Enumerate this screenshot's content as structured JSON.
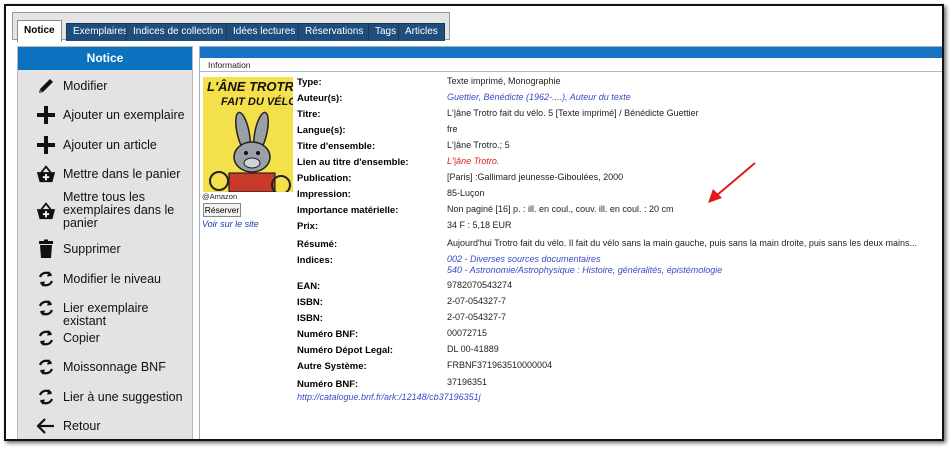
{
  "tabs": [
    "Notice",
    "Exemplaires",
    "Indices de collection",
    "Idées lectures",
    "Réservations",
    "Tags",
    "Articles"
  ],
  "sidebar": {
    "title": "Notice",
    "items": [
      {
        "label": "Modifier",
        "icon": "pencil-icon"
      },
      {
        "label": "Ajouter un exemplaire",
        "icon": "plus-icon"
      },
      {
        "label": "Ajouter un article",
        "icon": "plus-icon"
      },
      {
        "label": "Mettre dans le panier",
        "icon": "basket-add-icon"
      },
      {
        "label": "Mettre tous les exemplaires dans le panier",
        "icon": "basket-add-icon"
      },
      {
        "label": "Supprimer",
        "icon": "trash-icon"
      },
      {
        "label": "Modifier le niveau",
        "icon": "sync-icon"
      },
      {
        "label": "Lier exemplaire existant",
        "icon": "sync-icon"
      },
      {
        "label": "Copier",
        "icon": "sync-icon"
      },
      {
        "label": "Moissonnage BNF",
        "icon": "sync-icon"
      },
      {
        "label": "Lier à une suggestion",
        "icon": "sync-icon"
      },
      {
        "label": "Retour",
        "icon": "arrow-left-icon"
      }
    ]
  },
  "info": {
    "header": "Information",
    "cover_credit": "@Amazon",
    "cover_title_line1": "L'ÂNE TROTR",
    "cover_title_line2": "FAIT DU VÉLO",
    "reserve": "Réserver",
    "site_link": "Voir sur le site"
  },
  "record": [
    {
      "field": "Type:",
      "value": "Texte imprimé, Monographie",
      "style": "plain"
    },
    {
      "field": "Auteur(s):",
      "value": "Guettier, Bénédicte (1962-....), Auteur du texte",
      "style": "link"
    },
    {
      "field": "Titre:",
      "value": "L'|âne Trotro fait du vélo. 5 [Texte imprimé] / Bénédicte Guettier",
      "style": "plain"
    },
    {
      "field": "Langue(s):",
      "value": "fre",
      "style": "plain"
    },
    {
      "field": "Titre d'ensemble:",
      "value": "L'|âne Trotro.; 5",
      "style": "plain"
    },
    {
      "field": "Lien au titre d'ensemble:",
      "value": "L'|âne Trotro.",
      "style": "red"
    },
    {
      "field": "Publication:",
      "value": "[Paris] :Gallimard jeunesse-Giboulées, 2000",
      "style": "plain"
    },
    {
      "field": "Impression:",
      "value": "85-Luçon",
      "style": "plain"
    },
    {
      "field": "Importance matérielle:",
      "value": "Non paginé [16] p. : ill. en coul., couv. ill. en coul. : 20 cm",
      "style": "plain"
    },
    {
      "field": "Prix:",
      "value": "34 F : 5,18 EUR",
      "style": "plain"
    },
    {
      "field": "Résumé:",
      "value": "Aujourd'hui Trotro fait du vélo. Il fait du vélo sans la main gauche, puis sans la main droite, puis sans les deux mains...",
      "style": "plain"
    },
    {
      "field": "Indices:",
      "value": "002 - Diverses sources documentaires",
      "value2": "540 - Astronomie/Astrophysique : Histoire, généralités, épistémologie",
      "style": "link"
    },
    {
      "field": "EAN:",
      "value": "9782070543274",
      "style": "plain"
    },
    {
      "field": "ISBN:",
      "value": "2-07-054327-7",
      "style": "plain"
    },
    {
      "field": "ISBN:",
      "value": "2-07-054327-7",
      "style": "plain"
    },
    {
      "field": "Numéro BNF:",
      "value": "00072715",
      "style": "plain"
    },
    {
      "field": "Numéro Dépot Legal:",
      "value": "DL 00-41889",
      "style": "plain"
    },
    {
      "field": "Autre Système:",
      "value": "FRBNF371963510000004",
      "style": "plain"
    },
    {
      "field": "Numéro BNF:",
      "value": "37196351",
      "style": "plain"
    }
  ],
  "bnf_link": "http://catalogue.bnf.fr/ark:/12148/cb37196351j",
  "colors": {
    "accent_blue": "#0b72c0",
    "tab_blue": "#1f4e7c",
    "link": "#3a4ac9",
    "red": "#d9241f"
  }
}
